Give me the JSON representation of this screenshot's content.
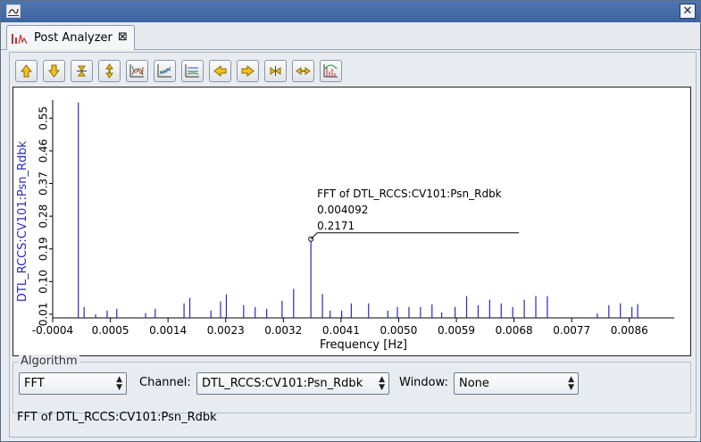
{
  "window": {
    "close_glyph": "✕"
  },
  "tab": {
    "label": "Post Analyzer",
    "close_glyph": "⊠"
  },
  "toolbar": {
    "buttons": [
      "up-arrow-icon",
      "down-arrow-icon",
      "shrink-vertical-icon",
      "expand-vertical-icon",
      "waveform-icon",
      "line-chart-icon",
      "axis-scale-icon",
      "left-arrow-icon",
      "right-arrow-icon",
      "shrink-horizontal-icon",
      "expand-horizontal-icon",
      "fft-icon"
    ]
  },
  "chart_data": {
    "type": "bar",
    "xlabel": "Frequency [Hz]",
    "ylabel": "DTL_RCCS:CV101:Psn_Rdbk",
    "xlim": [
      -0.0004,
      0.0093
    ],
    "ylim": [
      0,
      0.6
    ],
    "x_tick_labels": [
      "-0.0004",
      "0.0005",
      "0.0014",
      "0.0023",
      "0.0032",
      "0.0041",
      "0.0050",
      "0.0059",
      "0.0068",
      "0.0077",
      "0.0086"
    ],
    "x_tick_values": [
      -0.0004,
      0.0005,
      0.0014,
      0.0023,
      0.0032,
      0.0041,
      0.005,
      0.0059,
      0.0068,
      0.0077,
      0.0086
    ],
    "y_tick_labels": [
      "0.01",
      "0.10",
      "0.19",
      "0.28",
      "0.37",
      "0.46",
      "0.55"
    ],
    "y_tick_values": [
      0.01,
      0.1,
      0.19,
      0.28,
      0.37,
      0.46,
      0.55
    ],
    "x": [
      0,
      9e-05,
      0.00018,
      0.00027,
      0.00036,
      0.00045,
      0.00054,
      0.00063,
      0.00072,
      0.00081,
      0.0009,
      0.00099,
      0.00108,
      0.00117,
      0.00126,
      0.00135,
      0.00144,
      0.00153,
      0.00162,
      0.00171,
      0.0018,
      0.00189,
      0.00198,
      0.00207,
      0.00216,
      0.00225,
      0.00234,
      0.00243,
      0.00252,
      0.00261,
      0.0027,
      0.00279,
      0.00288,
      0.00297,
      0.00306,
      0.00315,
      0.00324,
      0.00333,
      0.00342,
      0.00351,
      0.0036,
      0.00369,
      0.00378,
      0.00387,
      0.00396,
      0.00405,
      0.00414,
      0.00423,
      0.00432,
      0.00441,
      0.0045,
      0.00459,
      0.00468,
      0.00477,
      0.00486,
      0.00495,
      0.00504,
      0.00513,
      0.00522,
      0.00531,
      0.0054,
      0.00549,
      0.00558,
      0.00567,
      0.00576,
      0.00585,
      0.00594,
      0.00603,
      0.00612,
      0.00621,
      0.0063,
      0.00639,
      0.00648,
      0.00657,
      0.00666,
      0.00675,
      0.00684,
      0.00693,
      0.00702,
      0.00711,
      0.0072,
      0.00729,
      0.00738,
      0.00747,
      0.00756,
      0.00765,
      0.00774,
      0.00783,
      0.00792,
      0.00801,
      0.0081,
      0.00819,
      0.00828,
      0.00837,
      0.00846,
      0.00855,
      0.00864,
      0.00873,
      0.00882,
      0.00891,
      0.009
    ],
    "y": [
      0.593,
      0.002,
      0.003,
      0.001,
      0.002,
      0.003,
      0.002,
      0.001,
      0.002,
      0.012,
      0.002,
      0.001,
      0.002,
      0.001,
      0.006,
      0.003,
      0.002,
      0.009,
      0.001,
      0.002,
      0.001,
      0.004,
      0.001,
      0.002,
      0.001,
      0.003,
      0.002,
      0.001,
      0.003,
      0.002,
      0.001,
      0.004,
      0.002,
      0.001,
      0.006,
      0.002,
      0.001,
      0.004,
      0.002,
      0.001,
      0.005,
      0.002,
      0.002,
      0.02,
      0.002,
      0.001,
      0.005,
      0.003,
      0.002,
      0.004,
      0.002,
      0.001,
      0.003,
      0.002,
      0.001,
      0.004,
      0.002,
      0.001,
      0.004,
      0.003,
      0.002,
      0.006,
      0.002,
      0.001,
      0.004,
      0.002,
      0.001,
      0.008,
      0.003,
      0.002,
      0.006,
      0.002,
      0.001,
      0.004,
      0.002,
      0.001,
      0.006,
      0.002,
      0.001,
      0.005,
      0.002,
      0.001,
      0.004,
      0.002,
      0.001,
      0.005,
      0.002,
      0.001,
      0.003,
      0.002,
      0.001,
      0.004,
      0.002,
      0.001,
      0.003,
      0.002,
      0.001,
      0.004,
      0.002,
      0.001,
      0.004
    ],
    "peaks": [
      {
        "x": 0.0,
        "y": 0.593
      },
      {
        "x": 9e-05,
        "y": 0.03
      },
      {
        "x": 0.00027,
        "y": 0.01
      },
      {
        "x": 0.00045,
        "y": 0.02
      },
      {
        "x": 0.0006,
        "y": 0.025
      },
      {
        "x": 0.00105,
        "y": 0.013
      },
      {
        "x": 0.0012,
        "y": 0.025
      },
      {
        "x": 0.00165,
        "y": 0.04
      },
      {
        "x": 0.00174,
        "y": 0.055
      },
      {
        "x": 0.00207,
        "y": 0.02
      },
      {
        "x": 0.00222,
        "y": 0.045
      },
      {
        "x": 0.00231,
        "y": 0.065
      },
      {
        "x": 0.00258,
        "y": 0.035
      },
      {
        "x": 0.00276,
        "y": 0.03
      },
      {
        "x": 0.00294,
        "y": 0.025
      },
      {
        "x": 0.00318,
        "y": 0.047
      },
      {
        "x": 0.00336,
        "y": 0.08
      },
      {
        "x": 0.00363,
        "y": 0.217
      },
      {
        "x": 0.00381,
        "y": 0.066
      },
      {
        "x": 0.00393,
        "y": 0.02
      },
      {
        "x": 0.00411,
        "y": 0.02
      },
      {
        "x": 0.00426,
        "y": 0.04
      },
      {
        "x": 0.00453,
        "y": 0.04
      },
      {
        "x": 0.00483,
        "y": 0.02
      },
      {
        "x": 0.00498,
        "y": 0.03
      },
      {
        "x": 0.00516,
        "y": 0.03
      },
      {
        "x": 0.00534,
        "y": 0.03
      },
      {
        "x": 0.00552,
        "y": 0.037
      },
      {
        "x": 0.00567,
        "y": 0.015
      },
      {
        "x": 0.00588,
        "y": 0.03
      },
      {
        "x": 0.00606,
        "y": 0.06
      },
      {
        "x": 0.00624,
        "y": 0.035
      },
      {
        "x": 0.00642,
        "y": 0.05
      },
      {
        "x": 0.0066,
        "y": 0.04
      },
      {
        "x": 0.00678,
        "y": 0.03
      },
      {
        "x": 0.00696,
        "y": 0.05
      },
      {
        "x": 0.00714,
        "y": 0.06
      },
      {
        "x": 0.00732,
        "y": 0.06
      },
      {
        "x": 0.0081,
        "y": 0.012
      },
      {
        "x": 0.00828,
        "y": 0.035
      },
      {
        "x": 0.00846,
        "y": 0.04
      },
      {
        "x": 0.00864,
        "y": 0.03
      },
      {
        "x": 0.00873,
        "y": 0.038
      }
    ],
    "marker": {
      "title": "FFT of DTL_RCCS:CV101:Psn_Rdbk",
      "x_label": "0.004092",
      "y_label": "0.2171",
      "x": 0.00363,
      "y": 0.217
    }
  },
  "algorithm": {
    "title": "Algorithm",
    "algorithm_value": "FFT",
    "channel_label": "Channel:",
    "channel_value": "DTL_RCCS:CV101:Psn_Rdbk",
    "window_label": "Window:",
    "window_value": "None"
  },
  "status_text": "FFT of DTL_RCCS:CV101:Psn_Rdbk",
  "colors": {
    "series": "#2a2ac0",
    "axis_label": "#2a2ac0",
    "titlebar": "#4a72ad"
  }
}
